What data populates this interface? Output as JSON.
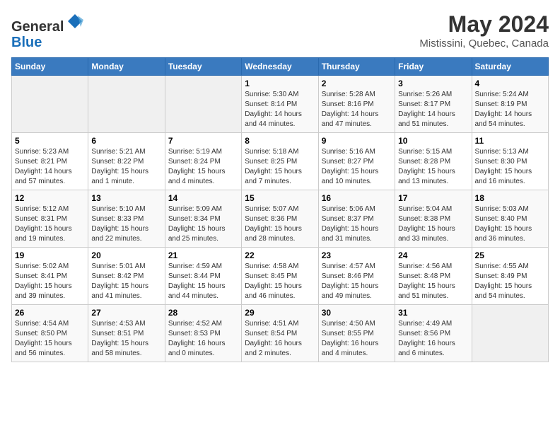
{
  "header": {
    "logo": {
      "general": "General",
      "blue": "Blue"
    },
    "title": "May 2024",
    "location": "Mistissini, Quebec, Canada"
  },
  "days_of_week": [
    "Sunday",
    "Monday",
    "Tuesday",
    "Wednesday",
    "Thursday",
    "Friday",
    "Saturday"
  ],
  "weeks": [
    [
      {
        "day": "",
        "sunrise": "",
        "sunset": "",
        "daylight": ""
      },
      {
        "day": "",
        "sunrise": "",
        "sunset": "",
        "daylight": ""
      },
      {
        "day": "",
        "sunrise": "",
        "sunset": "",
        "daylight": ""
      },
      {
        "day": "1",
        "sunrise": "Sunrise: 5:30 AM",
        "sunset": "Sunset: 8:14 PM",
        "daylight": "Daylight: 14 hours and 44 minutes."
      },
      {
        "day": "2",
        "sunrise": "Sunrise: 5:28 AM",
        "sunset": "Sunset: 8:16 PM",
        "daylight": "Daylight: 14 hours and 47 minutes."
      },
      {
        "day": "3",
        "sunrise": "Sunrise: 5:26 AM",
        "sunset": "Sunset: 8:17 PM",
        "daylight": "Daylight: 14 hours and 51 minutes."
      },
      {
        "day": "4",
        "sunrise": "Sunrise: 5:24 AM",
        "sunset": "Sunset: 8:19 PM",
        "daylight": "Daylight: 14 hours and 54 minutes."
      }
    ],
    [
      {
        "day": "5",
        "sunrise": "Sunrise: 5:23 AM",
        "sunset": "Sunset: 8:21 PM",
        "daylight": "Daylight: 14 hours and 57 minutes."
      },
      {
        "day": "6",
        "sunrise": "Sunrise: 5:21 AM",
        "sunset": "Sunset: 8:22 PM",
        "daylight": "Daylight: 15 hours and 1 minute."
      },
      {
        "day": "7",
        "sunrise": "Sunrise: 5:19 AM",
        "sunset": "Sunset: 8:24 PM",
        "daylight": "Daylight: 15 hours and 4 minutes."
      },
      {
        "day": "8",
        "sunrise": "Sunrise: 5:18 AM",
        "sunset": "Sunset: 8:25 PM",
        "daylight": "Daylight: 15 hours and 7 minutes."
      },
      {
        "day": "9",
        "sunrise": "Sunrise: 5:16 AM",
        "sunset": "Sunset: 8:27 PM",
        "daylight": "Daylight: 15 hours and 10 minutes."
      },
      {
        "day": "10",
        "sunrise": "Sunrise: 5:15 AM",
        "sunset": "Sunset: 8:28 PM",
        "daylight": "Daylight: 15 hours and 13 minutes."
      },
      {
        "day": "11",
        "sunrise": "Sunrise: 5:13 AM",
        "sunset": "Sunset: 8:30 PM",
        "daylight": "Daylight: 15 hours and 16 minutes."
      }
    ],
    [
      {
        "day": "12",
        "sunrise": "Sunrise: 5:12 AM",
        "sunset": "Sunset: 8:31 PM",
        "daylight": "Daylight: 15 hours and 19 minutes."
      },
      {
        "day": "13",
        "sunrise": "Sunrise: 5:10 AM",
        "sunset": "Sunset: 8:33 PM",
        "daylight": "Daylight: 15 hours and 22 minutes."
      },
      {
        "day": "14",
        "sunrise": "Sunrise: 5:09 AM",
        "sunset": "Sunset: 8:34 PM",
        "daylight": "Daylight: 15 hours and 25 minutes."
      },
      {
        "day": "15",
        "sunrise": "Sunrise: 5:07 AM",
        "sunset": "Sunset: 8:36 PM",
        "daylight": "Daylight: 15 hours and 28 minutes."
      },
      {
        "day": "16",
        "sunrise": "Sunrise: 5:06 AM",
        "sunset": "Sunset: 8:37 PM",
        "daylight": "Daylight: 15 hours and 31 minutes."
      },
      {
        "day": "17",
        "sunrise": "Sunrise: 5:04 AM",
        "sunset": "Sunset: 8:38 PM",
        "daylight": "Daylight: 15 hours and 33 minutes."
      },
      {
        "day": "18",
        "sunrise": "Sunrise: 5:03 AM",
        "sunset": "Sunset: 8:40 PM",
        "daylight": "Daylight: 15 hours and 36 minutes."
      }
    ],
    [
      {
        "day": "19",
        "sunrise": "Sunrise: 5:02 AM",
        "sunset": "Sunset: 8:41 PM",
        "daylight": "Daylight: 15 hours and 39 minutes."
      },
      {
        "day": "20",
        "sunrise": "Sunrise: 5:01 AM",
        "sunset": "Sunset: 8:42 PM",
        "daylight": "Daylight: 15 hours and 41 minutes."
      },
      {
        "day": "21",
        "sunrise": "Sunrise: 4:59 AM",
        "sunset": "Sunset: 8:44 PM",
        "daylight": "Daylight: 15 hours and 44 minutes."
      },
      {
        "day": "22",
        "sunrise": "Sunrise: 4:58 AM",
        "sunset": "Sunset: 8:45 PM",
        "daylight": "Daylight: 15 hours and 46 minutes."
      },
      {
        "day": "23",
        "sunrise": "Sunrise: 4:57 AM",
        "sunset": "Sunset: 8:46 PM",
        "daylight": "Daylight: 15 hours and 49 minutes."
      },
      {
        "day": "24",
        "sunrise": "Sunrise: 4:56 AM",
        "sunset": "Sunset: 8:48 PM",
        "daylight": "Daylight: 15 hours and 51 minutes."
      },
      {
        "day": "25",
        "sunrise": "Sunrise: 4:55 AM",
        "sunset": "Sunset: 8:49 PM",
        "daylight": "Daylight: 15 hours and 54 minutes."
      }
    ],
    [
      {
        "day": "26",
        "sunrise": "Sunrise: 4:54 AM",
        "sunset": "Sunset: 8:50 PM",
        "daylight": "Daylight: 15 hours and 56 minutes."
      },
      {
        "day": "27",
        "sunrise": "Sunrise: 4:53 AM",
        "sunset": "Sunset: 8:51 PM",
        "daylight": "Daylight: 15 hours and 58 minutes."
      },
      {
        "day": "28",
        "sunrise": "Sunrise: 4:52 AM",
        "sunset": "Sunset: 8:53 PM",
        "daylight": "Daylight: 16 hours and 0 minutes."
      },
      {
        "day": "29",
        "sunrise": "Sunrise: 4:51 AM",
        "sunset": "Sunset: 8:54 PM",
        "daylight": "Daylight: 16 hours and 2 minutes."
      },
      {
        "day": "30",
        "sunrise": "Sunrise: 4:50 AM",
        "sunset": "Sunset: 8:55 PM",
        "daylight": "Daylight: 16 hours and 4 minutes."
      },
      {
        "day": "31",
        "sunrise": "Sunrise: 4:49 AM",
        "sunset": "Sunset: 8:56 PM",
        "daylight": "Daylight: 16 hours and 6 minutes."
      },
      {
        "day": "",
        "sunrise": "",
        "sunset": "",
        "daylight": ""
      }
    ]
  ]
}
